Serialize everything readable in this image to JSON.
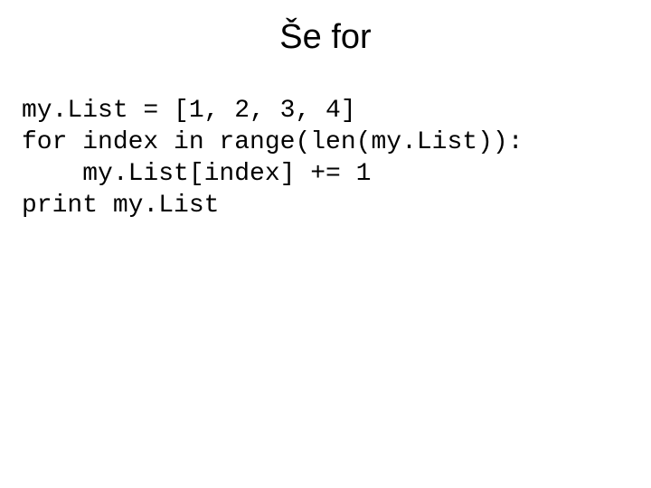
{
  "slide": {
    "title": "Še for",
    "code": {
      "line1": "my.List = [1, 2, 3, 4]",
      "line2": "for index in range(len(my.List)):",
      "line3": "    my.List[index] += 1",
      "line4": "print my.List"
    }
  }
}
